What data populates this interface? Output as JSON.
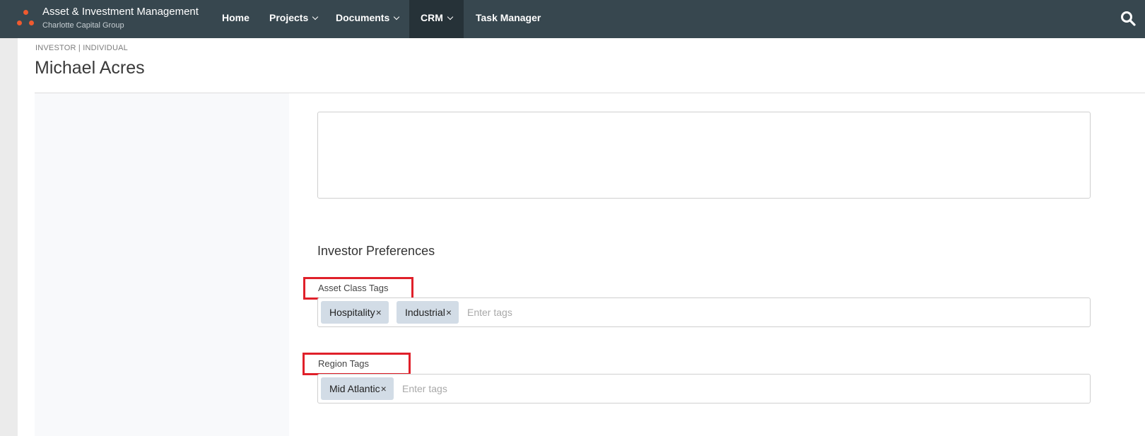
{
  "app": {
    "title": "Asset & Investment Management",
    "subtitle": "Charlotte Capital Group"
  },
  "nav": {
    "home": "Home",
    "projects": "Projects",
    "documents": "Documents",
    "crm": "CRM",
    "task_manager": "Task Manager",
    "active": "CRM"
  },
  "colors": {
    "navbar": "#37474f",
    "nav_active": "#263238",
    "logo_accent": "#ef5a2f",
    "tag_bg": "#d2dce6",
    "highlight": "#e0202a"
  },
  "header": {
    "breadcrumb": "INVESTOR | INDIVIDUAL",
    "title": "Michael Acres"
  },
  "notes": {
    "value": ""
  },
  "preferences": {
    "title": "Investor Preferences",
    "asset_class": {
      "label": "Asset Class Tags",
      "tags": [
        "Hospitality",
        "Industrial"
      ],
      "placeholder": "Enter tags"
    },
    "region": {
      "label": "Region Tags",
      "tags": [
        "Mid Atlantic"
      ],
      "placeholder": "Enter tags"
    }
  },
  "icons": {
    "search": "search-icon",
    "remove_tag": "×"
  }
}
